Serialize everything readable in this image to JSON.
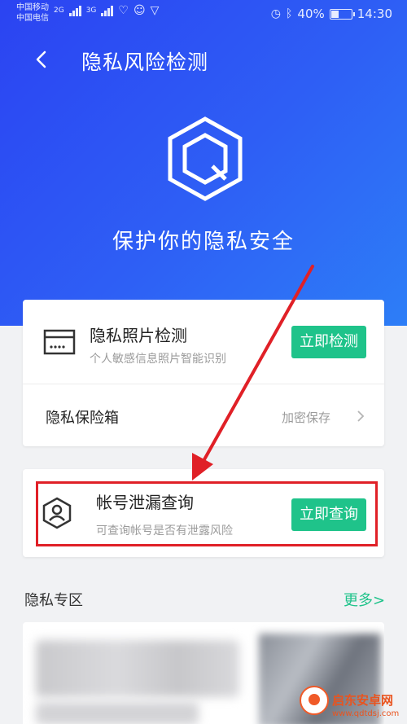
{
  "status_bar": {
    "carrier_1": "中国移动",
    "carrier_2": "中国电信",
    "net_1": "2G",
    "net_2": "3G",
    "battery_level": 0.4,
    "battery": "40%",
    "time": "14:30",
    "icons": [
      "heartbeat-icon",
      "qq-icon",
      "shield-icon",
      "alarm-icon",
      "bluetooth-icon"
    ]
  },
  "header": {
    "title": "隐私风险检测",
    "subtitle": "保护你的隐私安全"
  },
  "photo_check": {
    "title": "隐私照片检测",
    "subtitle": "个人敏感信息照片智能识别",
    "button": "立即检测"
  },
  "vault": {
    "title": "隐私保险箱",
    "hint": "加密保存"
  },
  "account_leak": {
    "title": "帐号泄漏查询",
    "subtitle": "可查询帐号是否有泄露风险",
    "button": "立即查询"
  },
  "privacy_zone": {
    "title": "隐私专区",
    "more": "更多>"
  },
  "watermark": {
    "text": "启东安卓网",
    "url": "www.qdtdsj.com"
  },
  "colors": {
    "hero_start": "#2b43f2",
    "hero_end": "#2d7ef7",
    "accent_green": "#1fc38a",
    "highlight_red": "#e02027"
  }
}
